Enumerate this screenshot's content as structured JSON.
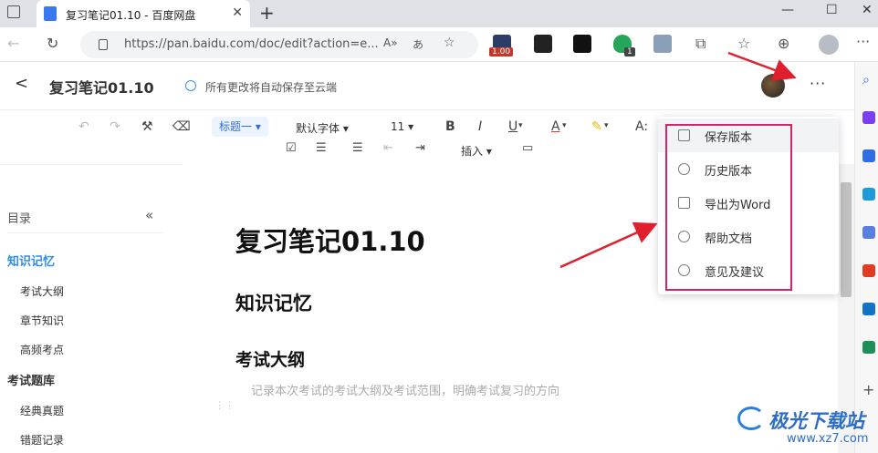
{
  "browser": {
    "tab_title": "复习笔记01.10 - 百度网盘",
    "tab_close": "✕",
    "new_tab": "+",
    "url": "https://pan.baidu.com/doc/edit?action=e...",
    "window_controls": {
      "minimize": "—",
      "maximize": "☐",
      "close": "✕"
    },
    "badges": {
      "ext_rating": "1.00",
      "ext_count": "1"
    },
    "nav_icons": [
      "back-arrow-icon",
      "refresh-icon",
      "lock-icon"
    ]
  },
  "doc_header": {
    "title": "复习笔记01.10",
    "save_status": "所有更改将自动保存至云端",
    "more_label": "···"
  },
  "toolbar": {
    "heading_style": "标题一",
    "font_family": "默认字体",
    "font_size": "11",
    "insert_label": "插入",
    "bold": "B",
    "italic": "I",
    "underline": "U",
    "font_color": "A",
    "font_size_adjust": "A:"
  },
  "menu": {
    "items": [
      {
        "label": "保存版本",
        "icon": "save-version-icon"
      },
      {
        "label": "历史版本",
        "icon": "history-clock-icon"
      },
      {
        "label": "导出为Word",
        "icon": "export-icon"
      },
      {
        "label": "帮助文档",
        "icon": "help-icon"
      },
      {
        "label": "意见及建议",
        "icon": "feedback-icon"
      }
    ]
  },
  "outline": {
    "title": "目录",
    "collapse": "«",
    "items": [
      {
        "label": "知识记忆",
        "level": 1,
        "active": true
      },
      {
        "label": "考试大纲",
        "level": 2
      },
      {
        "label": "章节知识",
        "level": 2
      },
      {
        "label": "高频考点",
        "level": 2
      },
      {
        "label": "考试题库",
        "level": 1
      },
      {
        "label": "经典真题",
        "level": 2
      },
      {
        "label": "错题记录",
        "level": 2
      }
    ]
  },
  "document": {
    "title": "复习笔记01.10",
    "section1": "知识记忆",
    "section2": "考试大纲",
    "placeholder": "记录本次考试的考试大纲及考试范围，明确考试复习的方向"
  },
  "watermark": {
    "main": "极光下载站",
    "sub": "www.xz7.com"
  },
  "colors": {
    "accent": "#2f8de6",
    "highlight": "#d6246a",
    "arrow": "#e01e2e"
  }
}
